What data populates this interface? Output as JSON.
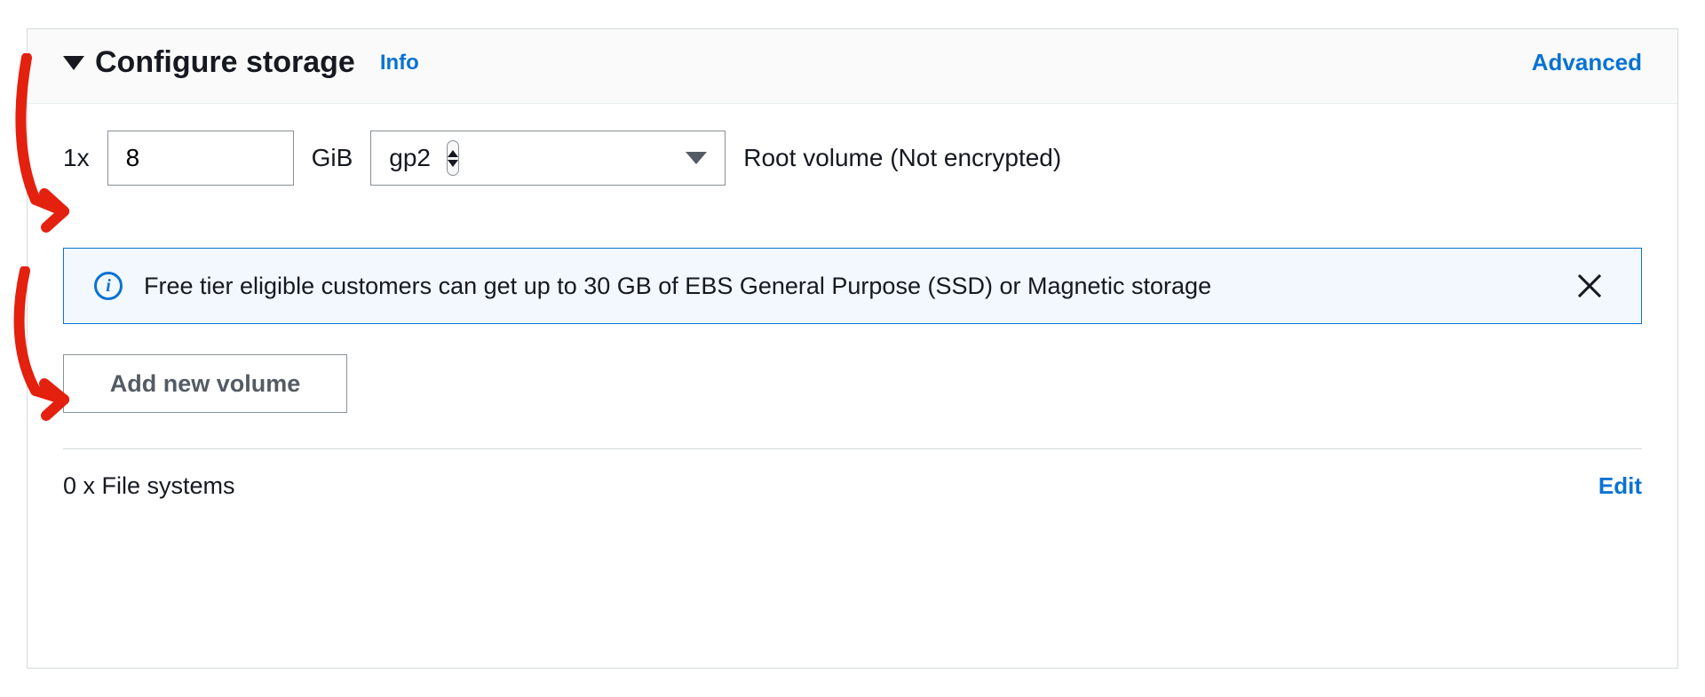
{
  "header": {
    "title": "Configure storage",
    "info_label": "Info",
    "advanced_label": "Advanced"
  },
  "volume": {
    "multiplier_prefix": "1x",
    "size_value": "8",
    "unit": "GiB",
    "type_selected": "gp2",
    "description": "Root volume  (Not encrypted)"
  },
  "flash": {
    "message": "Free tier eligible customers can get up to 30 GB of EBS General Purpose (SSD) or Magnetic storage"
  },
  "actions": {
    "add_volume_label": "Add new volume"
  },
  "filesystems": {
    "summary": "0 x File systems",
    "edit_label": "Edit"
  }
}
